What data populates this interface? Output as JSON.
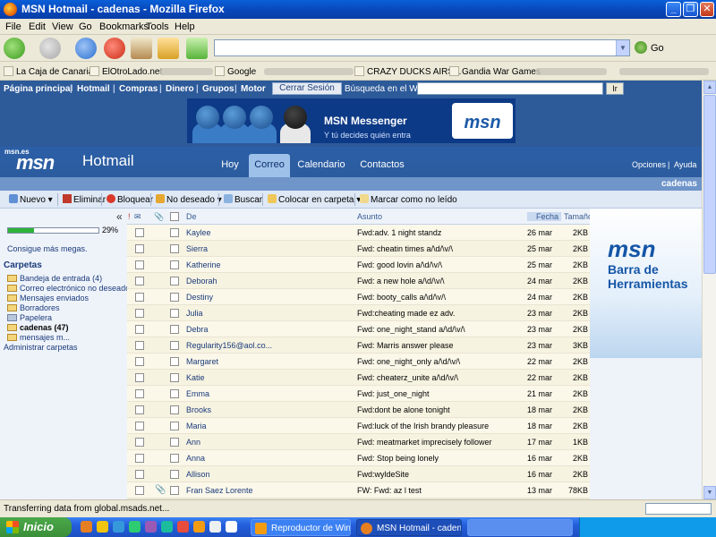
{
  "window": {
    "title": "MSN Hotmail - cadenas - Mozilla Firefox"
  },
  "menu": [
    "File",
    "Edit",
    "View",
    "Go",
    "Bookmarks",
    "Tools",
    "Help"
  ],
  "navbar": {
    "go_label": "Go",
    "url_value": ""
  },
  "bookmarks": [
    "La Caja de Canarias",
    "ElOtroLado.net",
    "Google",
    "CRAZY DUCKS AIRS...",
    "Gandia War Games"
  ],
  "msn_nav": {
    "links": [
      "Página principal",
      "Hotmail",
      "Compras",
      "Dinero",
      "Grupos",
      "Motor"
    ],
    "logout": "Cerrar Sesión",
    "search_label": "Búsqueda en el Web:",
    "search_value": "",
    "search_button": "Ir"
  },
  "banner": {
    "title": "MSN Messenger",
    "subtitle": "Y tú decides quién entra",
    "logo": "msn"
  },
  "hotmail_header": {
    "site_small": "msn.es",
    "logo": "msn",
    "product": "Hotmail",
    "tabs": [
      "Hoy",
      "Correo",
      "Calendario",
      "Contactos"
    ],
    "selected_tab": "Correo",
    "options": "Opciones",
    "help": "Ayuda",
    "current_folder": "cadenas"
  },
  "toolbar": {
    "new": "Nuevo",
    "delete": "Eliminar",
    "block": "Bloquear",
    "junk": "No deseado",
    "find": "Buscar",
    "move": "Colocar en carpeta",
    "mark_unread": "Marcar como no leído"
  },
  "sidebar": {
    "quota_fraction": 0.29,
    "quota_label": "29%",
    "more_space": "Consigue más megas.",
    "folders_title": "Carpetas",
    "folders": [
      {
        "label": "Bandeja de entrada (4)",
        "bold": false
      },
      {
        "label": "Correo electrónico no deseado",
        "bold": false
      },
      {
        "label": "Mensajes enviados",
        "bold": false
      },
      {
        "label": "Borradores",
        "bold": false
      },
      {
        "label": "Papelera",
        "bold": false
      },
      {
        "label": "cadenas (47)",
        "bold": true
      },
      {
        "label": "mensajes m...",
        "bold": false
      }
    ],
    "manage": "Administrar carpetas",
    "collapse_glyph": "«"
  },
  "list": {
    "headers": {
      "from": "De",
      "subject": "Asunto",
      "date": "Fecha",
      "size": "Tamaño"
    },
    "rows": [
      {
        "from": "Kaylee",
        "subject": "Fwd:adv. 1 night standz",
        "date": "26 mar",
        "size": "2KB",
        "attach": false
      },
      {
        "from": "Sierra",
        "subject": "Fwd: cheatin times a/\\d/\\v/\\",
        "date": "25 mar",
        "size": "2KB",
        "attach": false
      },
      {
        "from": "Katherine",
        "subject": "Fwd: good lovin a/\\d/\\v/\\",
        "date": "25 mar",
        "size": "2KB",
        "attach": false
      },
      {
        "from": "Deborah",
        "subject": "Fwd: a new hole a/\\d/\\v/\\",
        "date": "24 mar",
        "size": "2KB",
        "attach": false
      },
      {
        "from": "Destiny",
        "subject": "Fwd: booty_calls a/\\d/\\v/\\",
        "date": "24 mar",
        "size": "2KB",
        "attach": false
      },
      {
        "from": "Julia",
        "subject": "Fwd:cheating made ez adv.",
        "date": "23 mar",
        "size": "2KB",
        "attach": false
      },
      {
        "from": "Debra",
        "subject": "Fwd: one_night_stand a/\\d/\\v/\\",
        "date": "23 mar",
        "size": "2KB",
        "attach": false
      },
      {
        "from": "Regularity156@aol.co...",
        "subject": "Fwd: Marris answer please",
        "date": "23 mar",
        "size": "3KB",
        "attach": false
      },
      {
        "from": "Margaret",
        "subject": "Fwd: one_night_only a/\\d/\\v/\\",
        "date": "22 mar",
        "size": "2KB",
        "attach": false
      },
      {
        "from": "Katie",
        "subject": "Fwd: cheaterz_unite a/\\d/\\v/\\",
        "date": "22 mar",
        "size": "2KB",
        "attach": false
      },
      {
        "from": "Emma",
        "subject": "Fwd: just_one_night",
        "date": "21 mar",
        "size": "2KB",
        "attach": false
      },
      {
        "from": "Brooks",
        "subject": "Fwd:dont be alone tonight",
        "date": "18 mar",
        "size": "2KB",
        "attach": false
      },
      {
        "from": "Maria",
        "subject": "Fwd:luck of the Irish brandy pleasure",
        "date": "18 mar",
        "size": "2KB",
        "attach": false
      },
      {
        "from": "Ann",
        "subject": "Fwd: meatmarket imprecisely follower",
        "date": "17 mar",
        "size": "1KB",
        "attach": false
      },
      {
        "from": "Anna",
        "subject": "Fwd: Stop being lonely",
        "date": "16 mar",
        "size": "2KB",
        "attach": false
      },
      {
        "from": "Allison",
        "subject": "Fwd:wyldeSite",
        "date": "16 mar",
        "size": "2KB",
        "attach": false
      },
      {
        "from": "Fran Saez Lorente",
        "subject": "FW: Fwd: az l test",
        "date": "13 mar",
        "size": "78KB",
        "attach": true
      }
    ]
  },
  "ad": {
    "logo": "msn",
    "text": "Barra de Herramientas"
  },
  "status": {
    "text": "Transferring data from global.msads.net..."
  },
  "taskbar": {
    "start": "Inicio",
    "tasks": [
      "Reproductor de Win...",
      "MSN Hotmail - caden..."
    ]
  },
  "colors": {
    "msn_blue": "#2d5a99",
    "titlebar": "#0845b8",
    "taskbar": "#245edb",
    "start_green": "#3a8f38"
  }
}
